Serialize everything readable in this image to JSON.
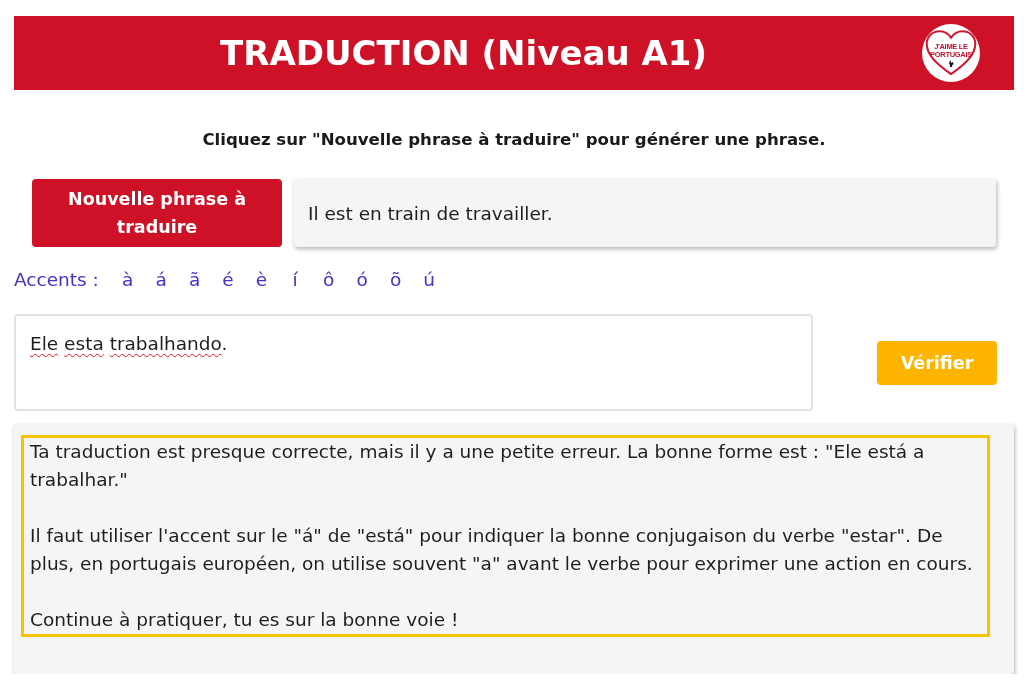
{
  "header": {
    "title": "TRADUCTION (Niveau A1)",
    "logo_text": [
      "J'AIME LE",
      "PORTUGAIS"
    ]
  },
  "instruction": "Cliquez sur \"Nouvelle phrase à traduire\" pour générer une phrase.",
  "new_sentence_button": "Nouvelle phrase à traduire",
  "sentence": "Il est en train de travailler.",
  "accents": {
    "label": "Accents :",
    "characters": [
      "à",
      "á",
      "ã",
      "é",
      "è",
      "í",
      "ô",
      "ó",
      "õ",
      "ú"
    ]
  },
  "answer": {
    "value": "Ele esta trabalhando.",
    "spellcheck_marked": true
  },
  "verify_button": "Vérifier",
  "feedback": {
    "paragraphs": [
      "Ta traduction est presque correcte, mais il y a une petite erreur. La bonne forme est : \"Ele está a trabalhar.\"",
      "Il faut utiliser l'accent sur le \"á\" de \"está\" pour indiquer la bonne conjugaison du verbe \"estar\". De plus, en portugais européen, on utilise souvent \"a\" avant le verbe pour exprimer une action en cours.",
      "Continue à pratiquer, tu es sur la bonne voie !"
    ]
  }
}
